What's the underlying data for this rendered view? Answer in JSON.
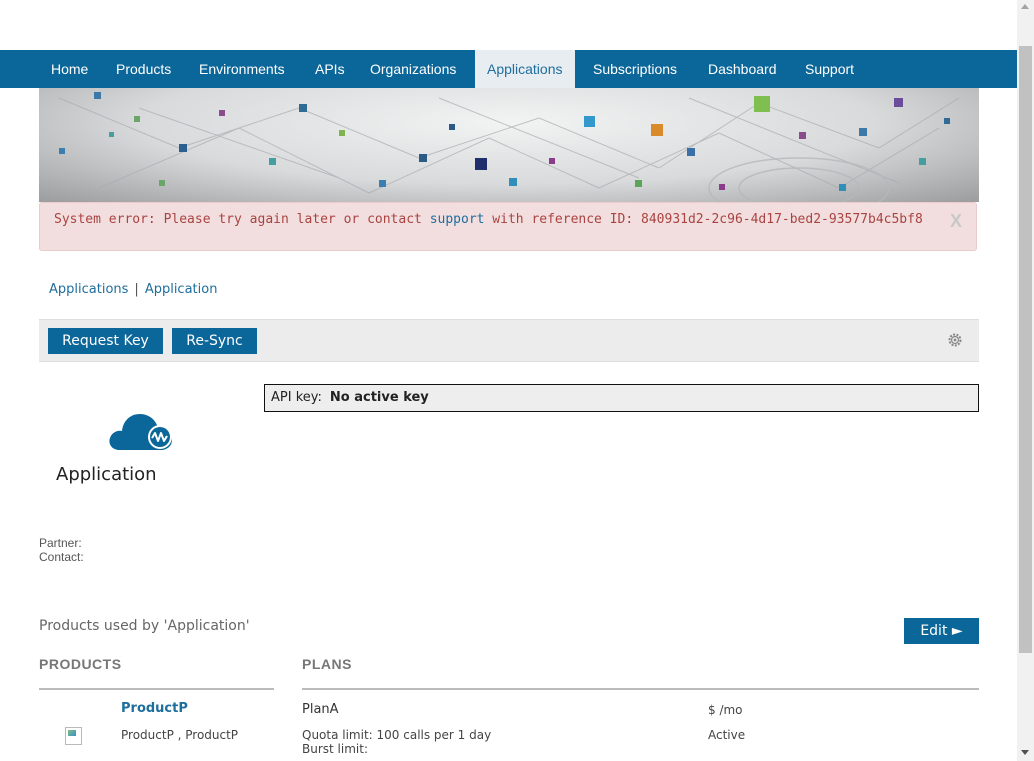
{
  "nav": {
    "items": [
      {
        "label": "Home"
      },
      {
        "label": "Products"
      },
      {
        "label": "Environments"
      },
      {
        "label": "APIs"
      },
      {
        "label": "Organizations"
      },
      {
        "label": "Applications",
        "active": true
      },
      {
        "label": "Subscriptions"
      },
      {
        "label": "Dashboard"
      },
      {
        "label": "Support"
      }
    ]
  },
  "alert": {
    "prefix": "System error: Please try again later or contact ",
    "link": "support",
    "suffix": " with reference ID: 840931d2-2c96-4d17-bed2-93577b4c5bf8",
    "close": "X"
  },
  "breadcrumb": {
    "parent": "Applications",
    "separator": "|",
    "current": "Application"
  },
  "toolbar": {
    "request_key": "Request Key",
    "resync": "Re-Sync",
    "settings_icon": "gear-icon"
  },
  "api_key": {
    "label": "API key:",
    "value": "No active key"
  },
  "app": {
    "name": "Application",
    "icon": "cloud-app-icon",
    "partner_label": "Partner:",
    "contact_label": "Contact:"
  },
  "products": {
    "title": "Products used by 'Application'",
    "edit": "Edit ►",
    "col_products": "PRODUCTS",
    "col_plans": "PLANS",
    "rows": [
      {
        "product_name": "ProductP",
        "product_sub": "ProductP  , ProductP",
        "plan": "PlanA",
        "price": "$ /mo",
        "quota": "Quota limit: 100 calls per 1 day",
        "burst": "Burst limit:",
        "status": "Active"
      }
    ]
  },
  "colors": {
    "nav_bg": "#0b6699",
    "accent": "#1e6e9e",
    "error_bg": "#f2dede",
    "error_text": "#a94442"
  }
}
